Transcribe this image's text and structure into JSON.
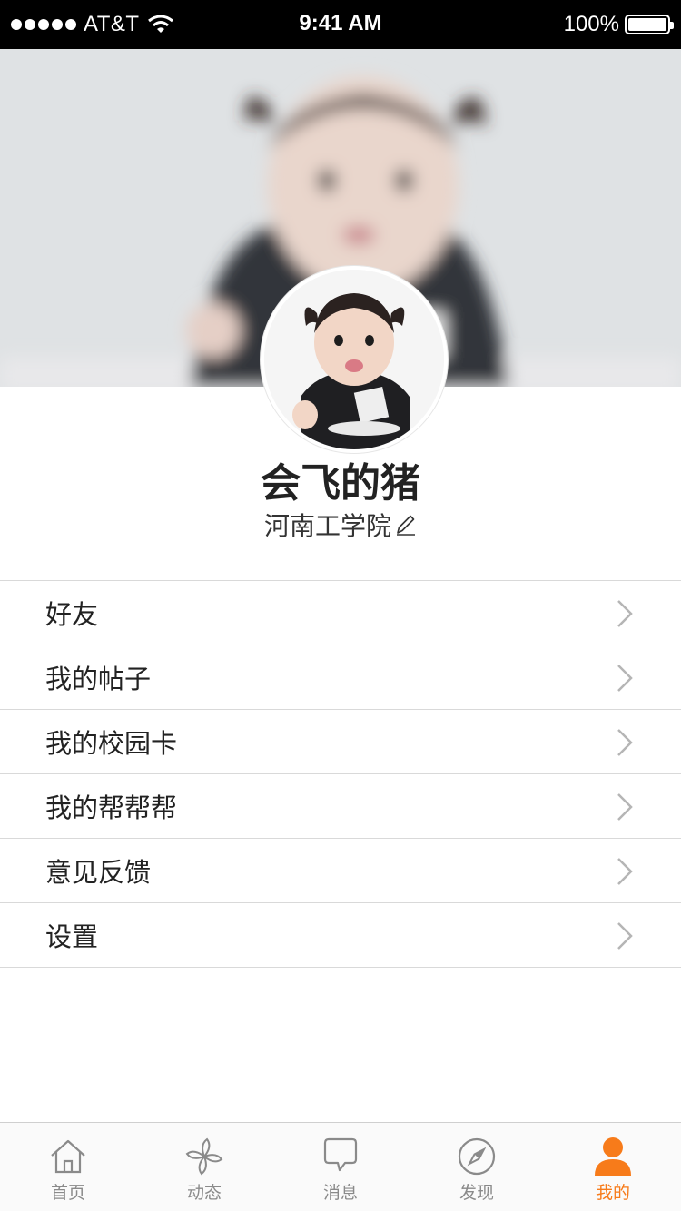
{
  "status_bar": {
    "carrier": "AT&T",
    "time": "9:41 AM",
    "battery": "100%"
  },
  "profile": {
    "username": "会飞的猪",
    "school": "河南工学院"
  },
  "menu": {
    "items": [
      {
        "label": "好友"
      },
      {
        "label": "我的帖子"
      },
      {
        "label": "我的校园卡"
      },
      {
        "label": "我的帮帮帮"
      },
      {
        "label": "意见反馈"
      },
      {
        "label": "设置"
      }
    ]
  },
  "tabbar": {
    "tabs": [
      {
        "label": "首页",
        "icon": "home-icon"
      },
      {
        "label": "动态",
        "icon": "pinwheel-icon"
      },
      {
        "label": "消息",
        "icon": "chat-bubble-icon"
      },
      {
        "label": "发现",
        "icon": "compass-icon"
      },
      {
        "label": "我的",
        "icon": "user-icon",
        "active": true
      }
    ],
    "active_color": "#f77b1a",
    "inactive_color": "#8a8a8a"
  }
}
